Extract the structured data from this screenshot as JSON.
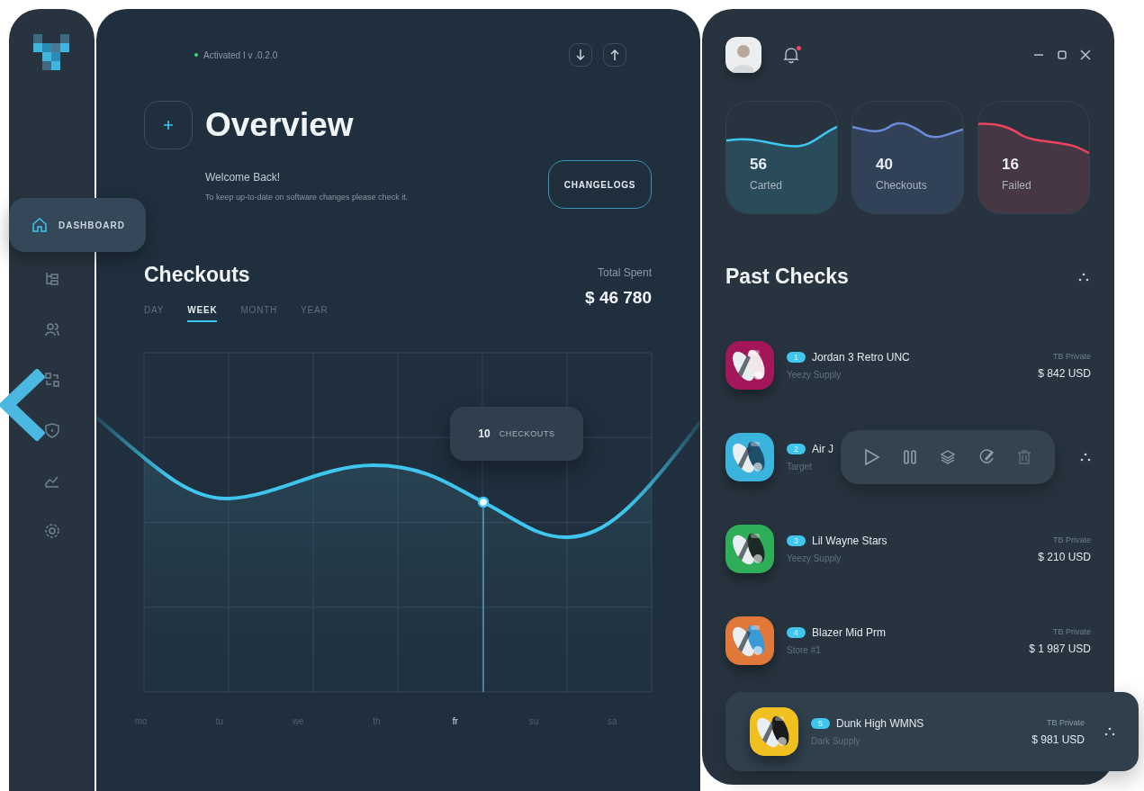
{
  "sidebar": {
    "items": [
      {
        "label": "DASHBOARD",
        "selected": true
      },
      {
        "selected": false
      },
      {
        "selected": false
      },
      {
        "selected": false
      },
      {
        "selected": false
      },
      {
        "selected": false
      },
      {
        "selected": false
      }
    ]
  },
  "header": {
    "status": "Activated I v .0.2.0"
  },
  "overview": {
    "title": "Overview",
    "greeting": "Welcome Back!",
    "message": "To keep up-to-date on software changes please check it.",
    "button": "CHANGELOGS"
  },
  "checkouts": {
    "title": "Checkouts",
    "tabs": [
      {
        "label": "DAY",
        "selected": false
      },
      {
        "label": "WEEK",
        "selected": true
      },
      {
        "label": "MONTH",
        "selected": false
      },
      {
        "label": "YEAR",
        "selected": false
      }
    ],
    "total_label": "Total Spent",
    "total": "$ 46 780",
    "tooltip": {
      "value": "10",
      "label": "CHECKOUTS"
    },
    "days": [
      {
        "label": "mo",
        "selected": false
      },
      {
        "label": "tu",
        "selected": false
      },
      {
        "label": "we",
        "selected": false
      },
      {
        "label": "th",
        "selected": false
      },
      {
        "label": "fr",
        "selected": true
      },
      {
        "label": "su",
        "selected": false
      },
      {
        "label": "sa",
        "selected": false
      }
    ]
  },
  "topbar": {
    "notification": true
  },
  "stats": [
    {
      "value": "56",
      "label": "Carted",
      "color": "#3ec6ee"
    },
    {
      "value": "40",
      "label": "Checkouts",
      "color": "#6b8ad8"
    },
    {
      "value": "16",
      "label": "Failed",
      "color": "#f0435e"
    }
  ],
  "past_checks": {
    "title": "Past Checks",
    "rows": [
      {
        "index": "1",
        "name": "Jordan 3 Retro UNC",
        "store": "Yeezy Supply",
        "account": "TB Private",
        "price": "$ 842 USD",
        "selected": false,
        "actions_open": false
      },
      {
        "index": "2",
        "name": "Air J",
        "store": "Target",
        "selected": false,
        "actions_open": true
      },
      {
        "index": "3",
        "name": "Lil Wayne Stars",
        "store": "Yeezy Supply",
        "account": "TB Private",
        "price": "$ 210 USD",
        "selected": false,
        "actions_open": false
      },
      {
        "index": "4",
        "name": "Blazer Mid Prm",
        "store": "Store #1",
        "account": "TB Private",
        "price": "$ 1 987 USD",
        "selected": false,
        "actions_open": false
      },
      {
        "index": "5",
        "name": "Dunk High WMNS",
        "store": "Dark Supply",
        "account": "TB Private",
        "price": "$ 981 USD",
        "selected": true,
        "actions_open": false
      }
    ]
  }
}
